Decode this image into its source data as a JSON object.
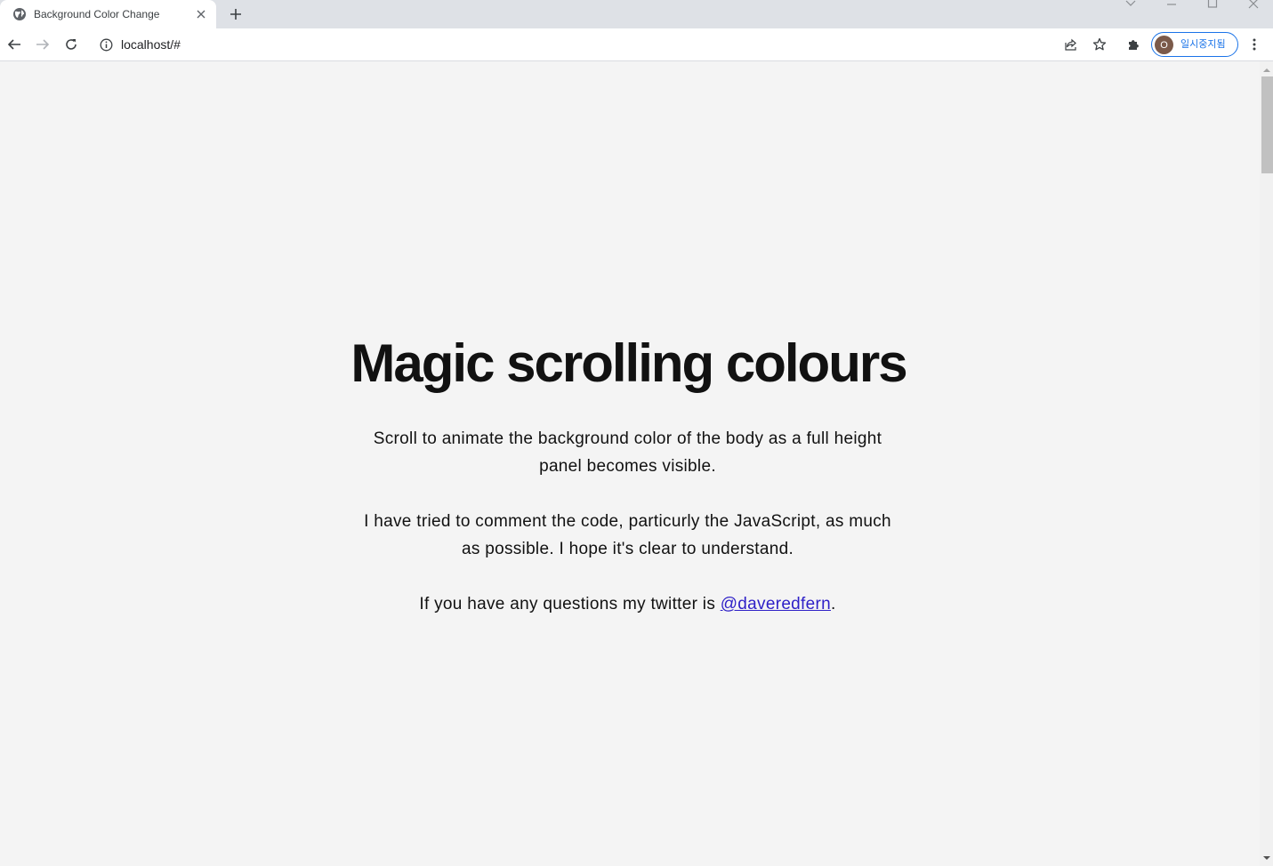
{
  "browser": {
    "tab": {
      "title": "Background Color Change",
      "favicon": "globe-icon"
    },
    "address_bar": {
      "url": "localhost/#"
    },
    "profile": {
      "initial": "O",
      "label": "일시중지됨",
      "accent": "#1a73e8",
      "avatar_color": "#7b5a4a"
    }
  },
  "page": {
    "background": "#f4f4f4",
    "title": "Magic scrolling colours",
    "paragraph1": "Scroll to animate the background color of the body as a full height panel becomes visible.",
    "paragraph2": "I have tried to comment the code, particurly the JavaScript, as much as possible. I hope it's clear to understand.",
    "paragraph3_prefix": "If you have any questions my twitter is ",
    "twitter_link": "@daveredfern",
    "paragraph3_suffix": ".",
    "link_color": "#2d1fc7"
  }
}
